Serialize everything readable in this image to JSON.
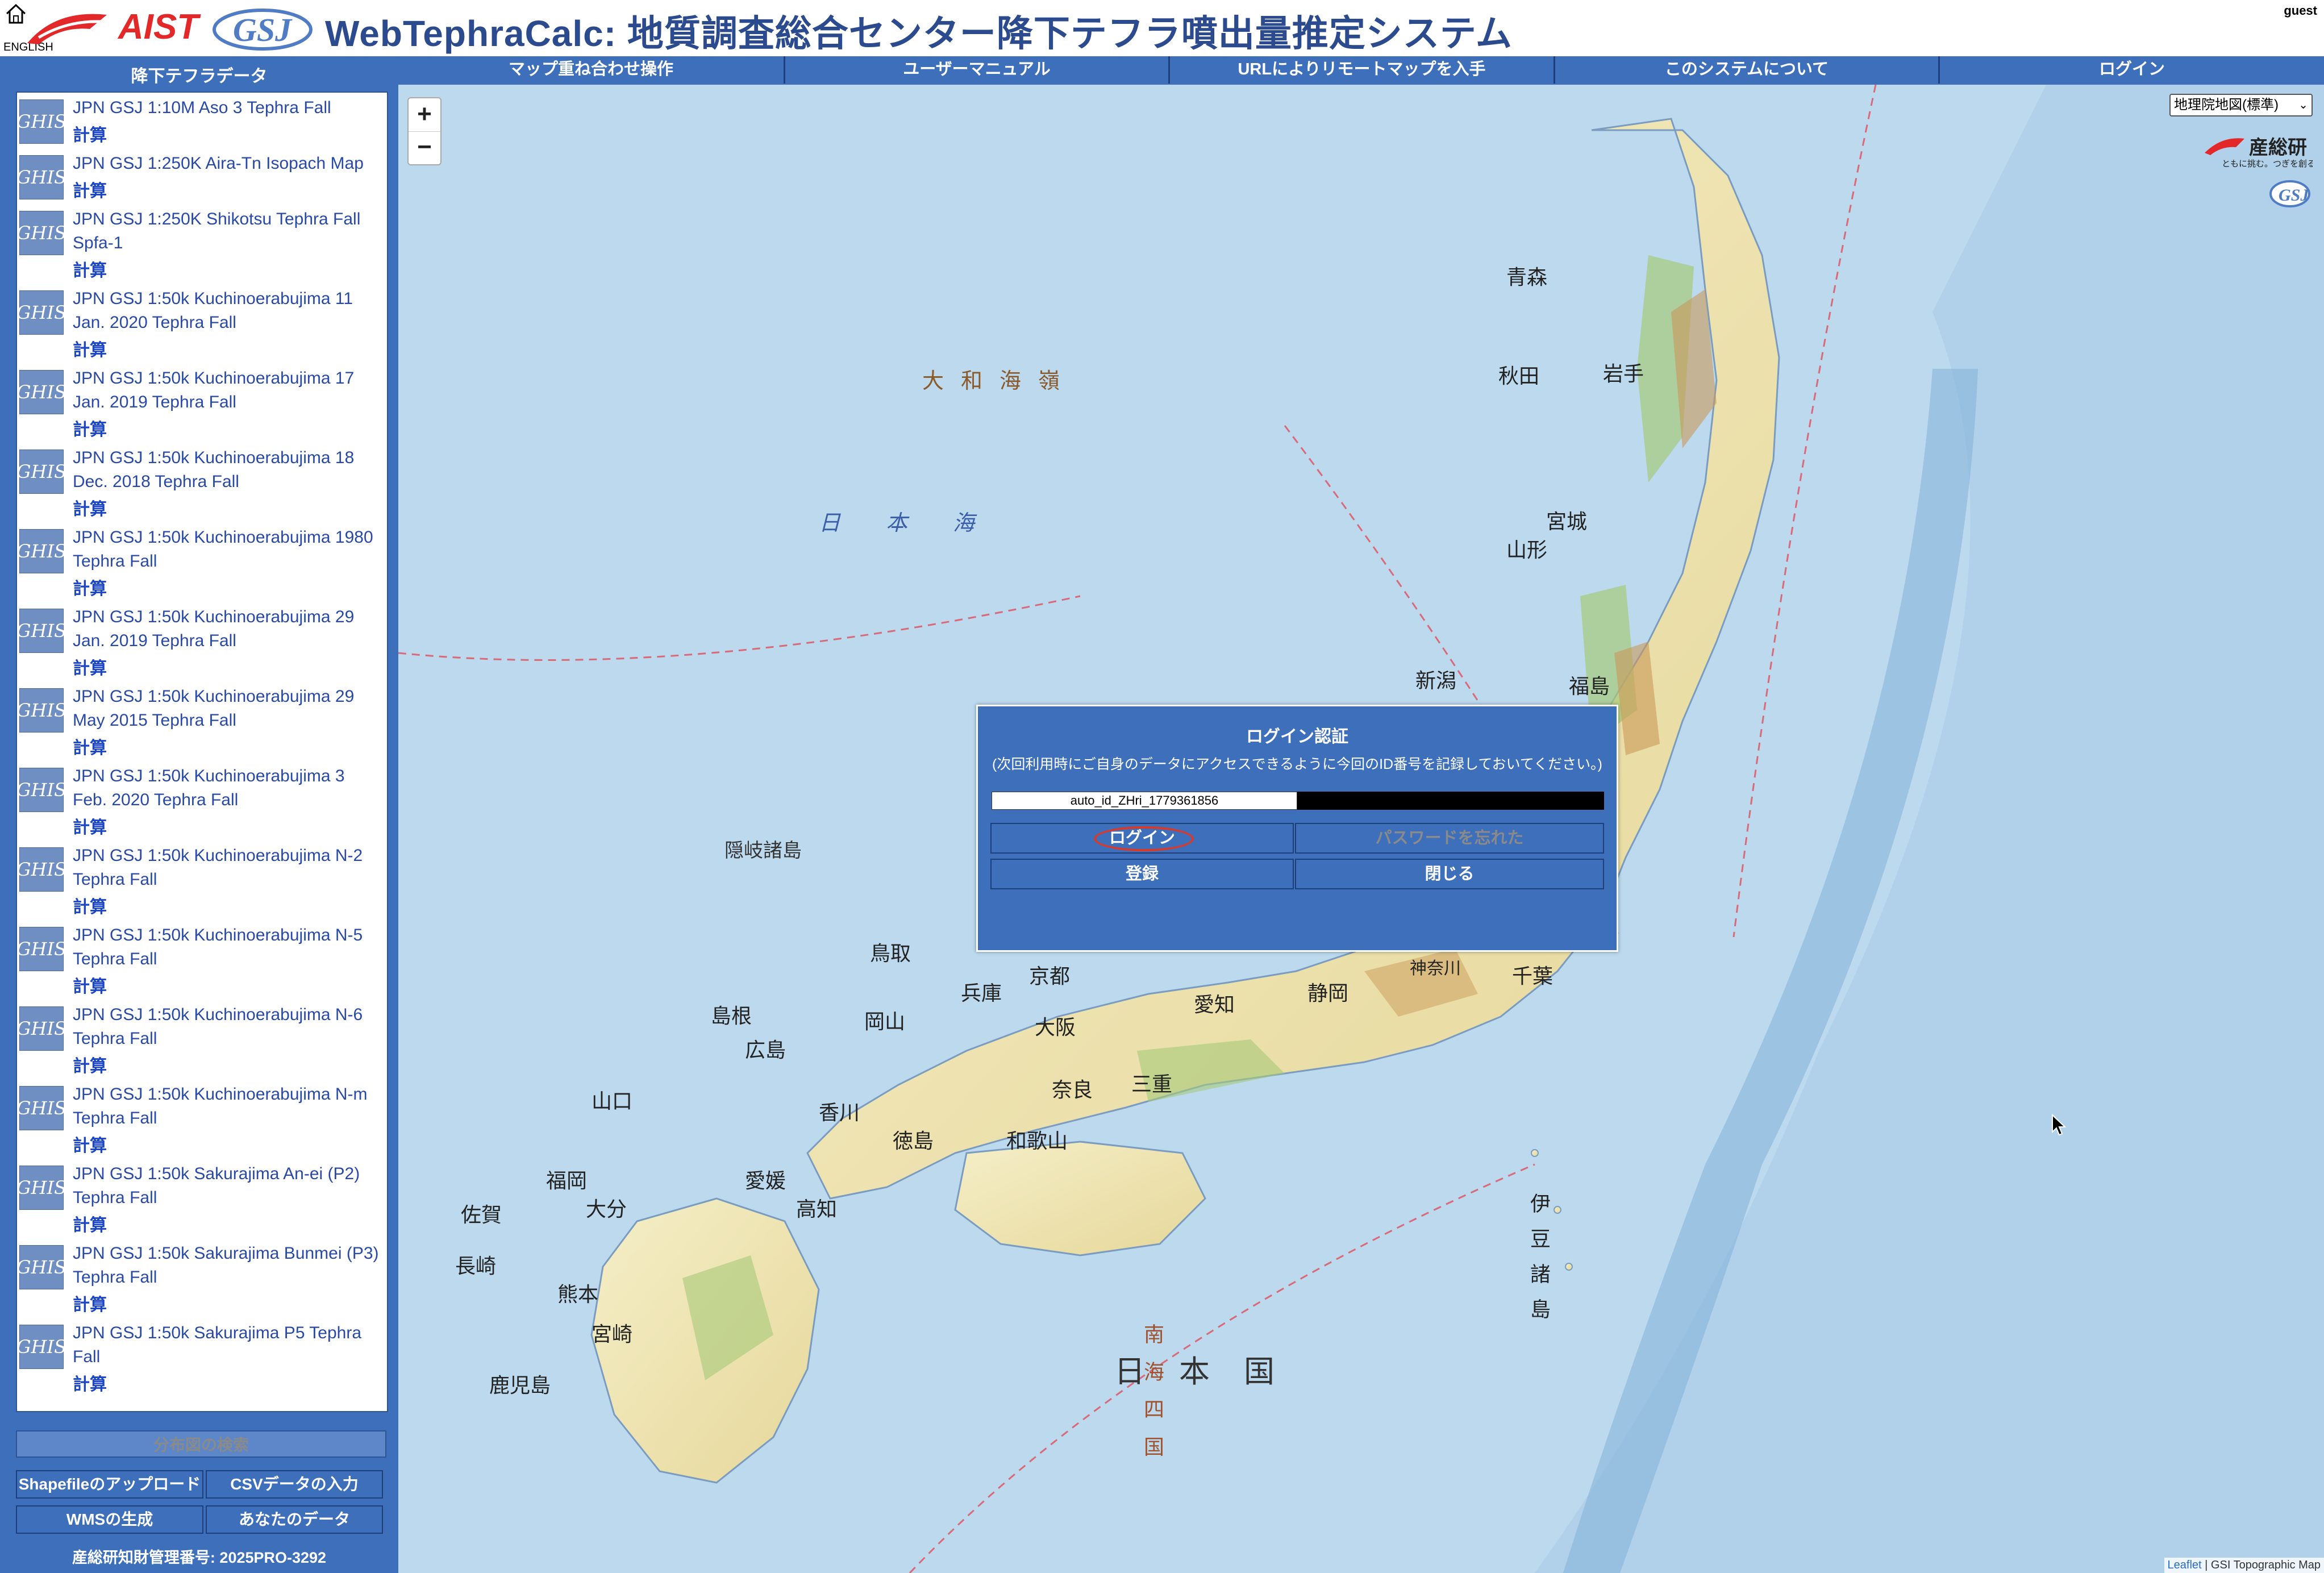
{
  "header": {
    "lang_link": "ENGLISH",
    "logo_aist": "AIST",
    "logo_gsj": "GSJ",
    "title": "WebTephraCalc: 地質調査総合センター降下テフラ噴出量推定システム",
    "user": "guest"
  },
  "sidebar": {
    "title": "降下テフラデータ",
    "icon_label": "GHIS",
    "calc_label": "計算",
    "items": [
      {
        "name": "JPN GSJ 1:10M Aso 3 Tephra Fall"
      },
      {
        "name": "JPN GSJ 1:250K Aira-Tn Isopach Map"
      },
      {
        "name": "JPN GSJ 1:250K Shikotsu Tephra Fall Spfa-1"
      },
      {
        "name": "JPN GSJ 1:50k Kuchinoerabujima 11 Jan. 2020 Tephra Fall"
      },
      {
        "name": "JPN GSJ 1:50k Kuchinoerabujima 17 Jan. 2019 Tephra Fall"
      },
      {
        "name": "JPN GSJ 1:50k Kuchinoerabujima 18 Dec. 2018 Tephra Fall"
      },
      {
        "name": "JPN GSJ 1:50k Kuchinoerabujima 1980 Tephra Fall"
      },
      {
        "name": "JPN GSJ 1:50k Kuchinoerabujima 29 Jan. 2019 Tephra Fall"
      },
      {
        "name": "JPN GSJ 1:50k Kuchinoerabujima 29 May 2015 Tephra Fall"
      },
      {
        "name": "JPN GSJ 1:50k Kuchinoerabujima 3 Feb. 2020 Tephra Fall"
      },
      {
        "name": "JPN GSJ 1:50k Kuchinoerabujima N-2 Tephra Fall"
      },
      {
        "name": "JPN GSJ 1:50k Kuchinoerabujima N-5 Tephra Fall"
      },
      {
        "name": "JPN GSJ 1:50k Kuchinoerabujima N-6 Tephra Fall"
      },
      {
        "name": "JPN GSJ 1:50k Kuchinoerabujima N-m Tephra Fall"
      },
      {
        "name": "JPN GSJ 1:50k Sakurajima An-ei (P2) Tephra Fall"
      },
      {
        "name": "JPN GSJ 1:50k Sakurajima Bunmei (P3) Tephra Fall"
      },
      {
        "name": "JPN GSJ 1:50k Sakurajima P5 Tephra Fall"
      }
    ],
    "search_button": "分布図の検索",
    "shapefile_button": "Shapefileのアップロード",
    "csv_button": "CSVデータの入力",
    "wms_button": "WMSの生成",
    "your_data_button": "あなたのデータ",
    "license": "産総研知財管理番号: 2025PRO-3292"
  },
  "nav": {
    "items": [
      "マップ重ね合わせ操作",
      "ユーザーマニュアル",
      "URLによりリモートマップを入手",
      "このシステムについて",
      "ログイン"
    ]
  },
  "map": {
    "zoom_in": "+",
    "zoom_out": "−",
    "basemap_select": "地理院地図(標準)",
    "logo_sanso": "産総研",
    "logo_sanso_sub": "ともに挑む。つぎを創る。",
    "attribution_leaflet": "Leaflet",
    "attribution_rest": " | GSI Topographic Map",
    "labels": {
      "sea_japan": "日本海",
      "yamato": "大和海嶺",
      "nihonkoku": "日本国",
      "oki": "隠岐諸島",
      "akita": "秋田",
      "iwate": "岩手",
      "aomori": "青森",
      "yamagata": "山形",
      "miyagi": "宮城",
      "niigata": "新潟",
      "fukushima": "福島",
      "tottori": "鳥取",
      "shimane": "島根",
      "okayama": "岡山",
      "hiroshima": "広島",
      "hyogo": "兵庫",
      "kyoto": "京都",
      "osaka": "大阪",
      "nara": "奈良",
      "wakayama": "和歌山",
      "mie": "三重",
      "aichi": "愛知",
      "shizuoka": "静岡",
      "kanagawa": "神奈川",
      "chiba": "千葉",
      "yamaguchi": "山口",
      "fukuoka": "福岡",
      "oita": "大分",
      "saga": "佐賀",
      "nagasaki": "長崎",
      "kumamoto": "熊本",
      "miyazaki": "宮崎",
      "kagoshima": "鹿児島",
      "ehime": "愛媛",
      "kochi": "高知",
      "kagawa": "香川",
      "tokushima": "徳島",
      "izu": "伊豆諸島",
      "nanpo": "南海四国"
    }
  },
  "dialog": {
    "title": "ログイン認証",
    "note": "(次回利用時にご自身のデータにアクセスできるように今回のID番号を記録しておいてください。)",
    "id_value": "auto_id_ZHri_1779361856",
    "login_button": "ログイン",
    "forgot_button": "パスワードを忘れた",
    "register_button": "登録",
    "close_button": "閉じる"
  }
}
